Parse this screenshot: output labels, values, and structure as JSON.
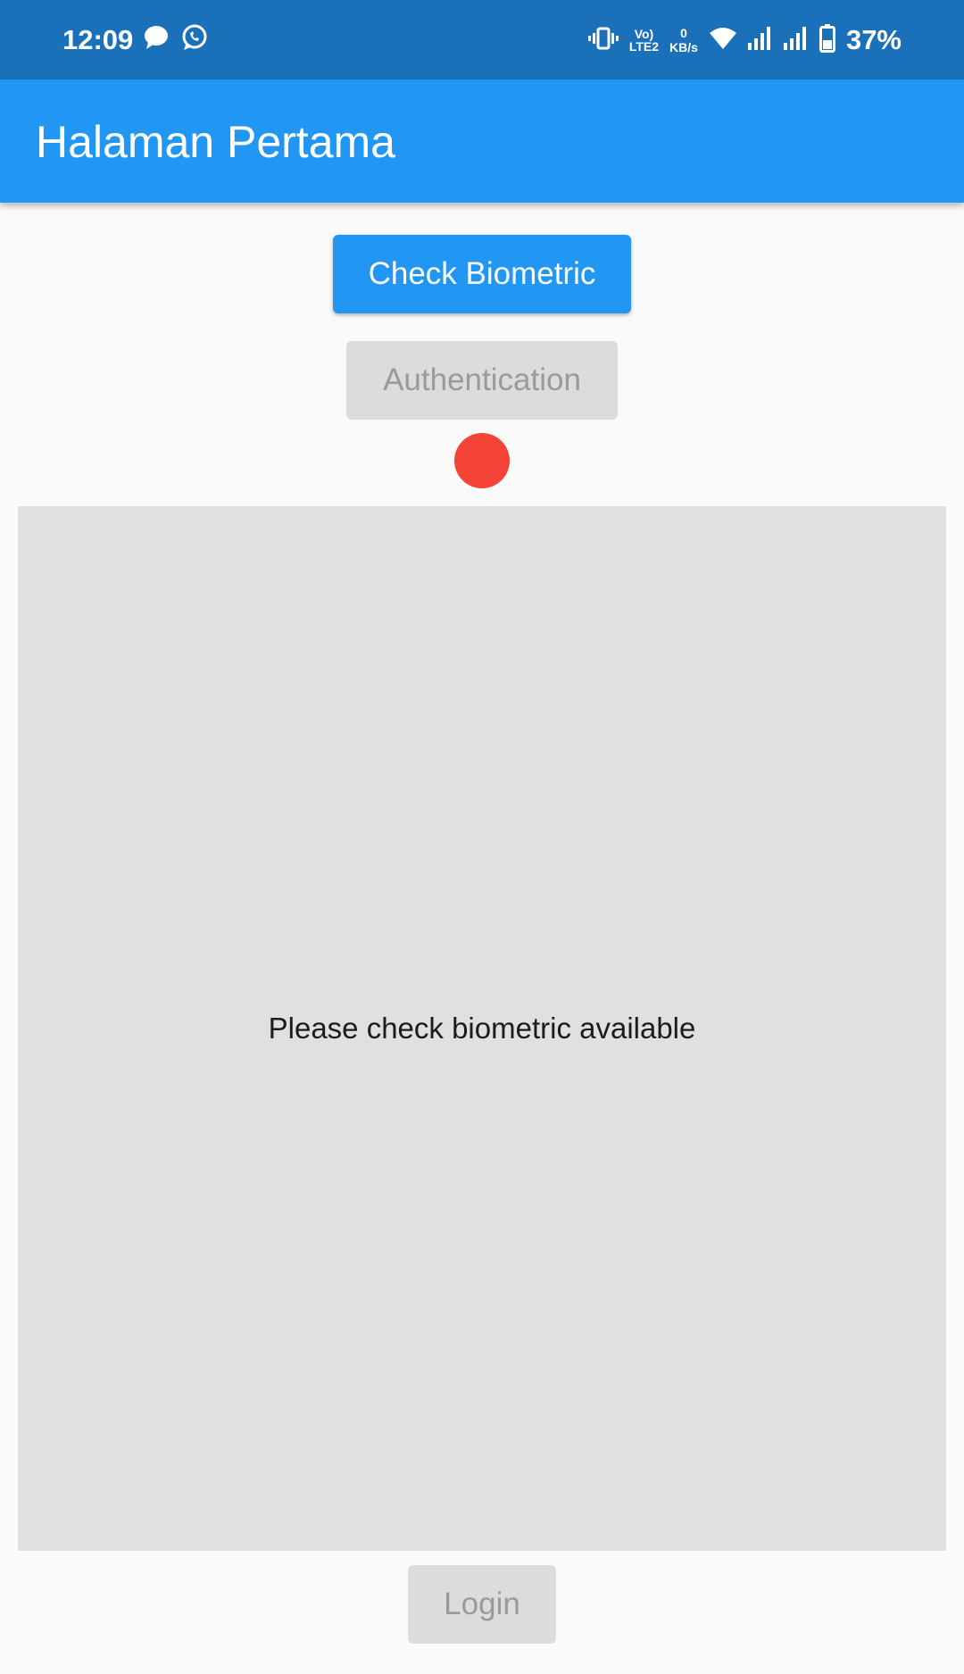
{
  "status_bar": {
    "time": "12:09",
    "volte_line1": "Vo)",
    "volte_line2": "LTE2",
    "speed_value": "0",
    "speed_unit": "KB/s",
    "battery": "37%",
    "icons": [
      "chat-bubble-icon",
      "whatsapp-icon",
      "vibrate-icon",
      "wifi-icon",
      "signal-icon",
      "signal-icon",
      "battery-icon"
    ]
  },
  "app_bar": {
    "title": "Halaman Pertama"
  },
  "buttons": {
    "check_biometric": "Check Biometric",
    "authentication": "Authentication",
    "login": "Login"
  },
  "indicator": {
    "color": "#f44336"
  },
  "message": {
    "text": "Please check biometric available"
  },
  "colors": {
    "primary": "#2196f3",
    "status_bar": "#1b70ba",
    "disabled_bg": "#dcdcdc",
    "disabled_text": "#9a9a9a",
    "panel_bg": "#e0e0e0"
  }
}
